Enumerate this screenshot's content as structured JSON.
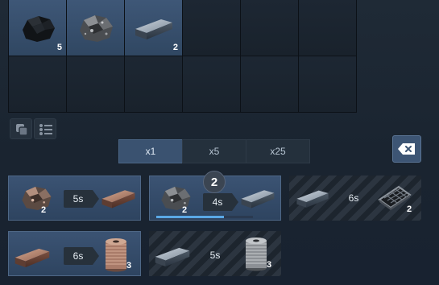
{
  "inventory": {
    "slots": [
      {
        "item": "coal-lump-icon",
        "count": "5"
      },
      {
        "item": "ore-chunk-icon",
        "count": ""
      },
      {
        "item": "metal-ingot-icon",
        "count": "2"
      }
    ]
  },
  "toolbar": {
    "stack_icon": "stack-icon",
    "list_icon": "list-icon"
  },
  "multiplier_tabs": [
    {
      "label": "x1",
      "active": true
    },
    {
      "label": "x5",
      "active": false
    },
    {
      "label": "x25",
      "active": false
    }
  ],
  "clear_icon": "backspace-icon",
  "recipes": [
    {
      "input": "ore-chunk-icon",
      "input_qty": "2",
      "time": "5s",
      "output": "copper-ingot-icon",
      "output_qty": "",
      "state": "available"
    },
    {
      "input": "ore-chunk-icon",
      "input_qty": "2",
      "time": "4s",
      "output": "metal-ingot-icon",
      "output_qty": "",
      "state": "in-progress",
      "queued": "2",
      "progress": 0.7
    },
    {
      "input": "metal-ingot-icon",
      "input_qty": "",
      "time": "6s",
      "output": "mesh-plate-icon",
      "output_qty": "2",
      "state": "locked"
    },
    {
      "input": "copper-ingot-icon",
      "input_qty": "",
      "time": "6s",
      "output": "copper-wire-spool-icon",
      "output_qty": "3",
      "state": "available"
    },
    {
      "input": "metal-ingot-icon",
      "input_qty": "",
      "time": "5s",
      "output": "wire-spool-icon",
      "output_qty": "3",
      "state": "locked"
    }
  ],
  "colors": {
    "slot_filled": "#3e5777",
    "recipe_bg": "#3b5373",
    "progress": "#5aa8e6",
    "locked_stripe": "#2c3540"
  }
}
